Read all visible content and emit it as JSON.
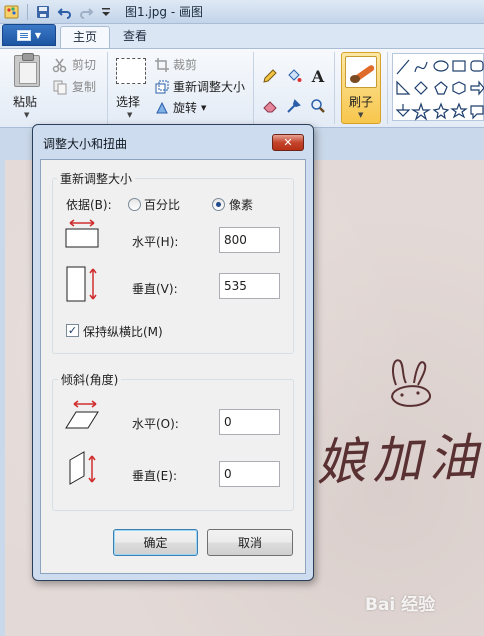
{
  "window": {
    "title": "图1.jpg - 画图"
  },
  "ribbon": {
    "tabs": [
      {
        "label": "主页",
        "active": true
      },
      {
        "label": "查看",
        "active": false
      }
    ],
    "clipboard": {
      "paste_label": "粘贴",
      "cut_label": "剪切",
      "copy_label": "复制"
    },
    "image": {
      "select_label": "选择",
      "crop_label": "裁剪",
      "resize_label": "重新调整大小",
      "rotate_label": "旋转"
    },
    "tools": {
      "text_tool_glyph": "A"
    },
    "brushes_label": "刷子"
  },
  "dialog": {
    "title": "调整大小和扭曲",
    "close_glyph": "✕",
    "resize": {
      "group_label": "重新调整大小",
      "by_label": "依据(B):",
      "percent_label": "百分比",
      "pixels_label": "像素",
      "selected_mode": "pixels",
      "horizontal_label": "水平(H):",
      "horizontal_value": "800",
      "vertical_label": "垂直(V):",
      "vertical_value": "535",
      "keep_ratio_label": "保持纵横比(M)",
      "keep_ratio_checked": true
    },
    "skew": {
      "group_label": "倾斜(角度)",
      "horizontal_label": "水平(O):",
      "horizontal_value": "0",
      "vertical_label": "垂直(E):",
      "vertical_value": "0"
    },
    "ok_label": "确定",
    "cancel_label": "取消"
  },
  "canvas": {
    "handwriting_text": "娘加油",
    "watermark_text": "Bai 经验"
  },
  "colors": {
    "accent_red": "#d12d2d",
    "brush_highlight": "#f7c64c",
    "menu_blue": "#1c55a2"
  }
}
